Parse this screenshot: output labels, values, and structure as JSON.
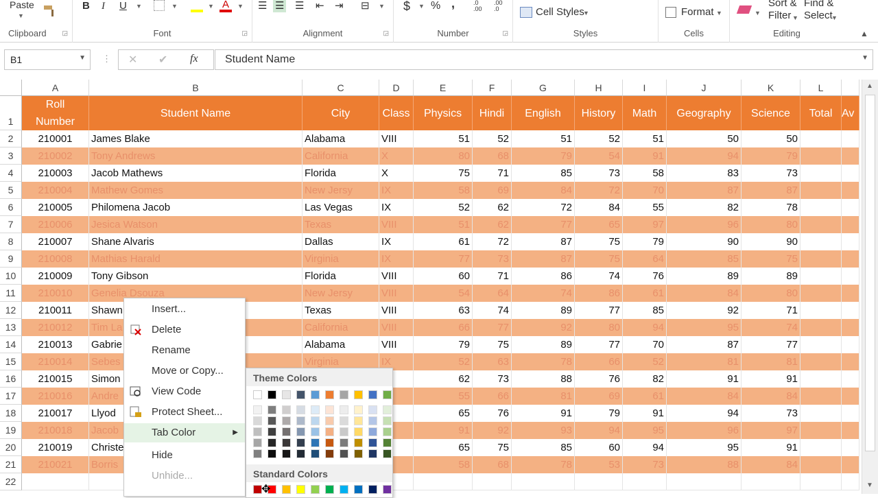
{
  "ribbon": {
    "paste_label": "Paste",
    "groups": {
      "clipboard": "Clipboard",
      "font": "Font",
      "alignment": "Alignment",
      "number": "Number",
      "styles": "Styles",
      "cells": "Cells",
      "editing": "Editing"
    },
    "cell_styles_label": "Cell Styles",
    "format_label": "Format",
    "sort_label": "Sort &",
    "filter_label": "Filter",
    "find_label": "Find &",
    "select_label": "Select",
    "bold": "B",
    "italic": "I",
    "underline": "U",
    "currency": "$",
    "percent": "%",
    "comma": ","
  },
  "formula_bar": {
    "name_box": "B1",
    "cancel_symbol": "✕",
    "enter_symbol": "✔",
    "fx_label": "fx",
    "content": "Student Name"
  },
  "columns": [
    {
      "letter": "A",
      "header_line1": "Roll",
      "header_line2": "Number"
    },
    {
      "letter": "B",
      "header": "Student Name"
    },
    {
      "letter": "C",
      "header": "City"
    },
    {
      "letter": "D",
      "header": "Class"
    },
    {
      "letter": "E",
      "header": "Physics"
    },
    {
      "letter": "F",
      "header": "Hindi"
    },
    {
      "letter": "G",
      "header": "English"
    },
    {
      "letter": "H",
      "header": "History"
    },
    {
      "letter": "I",
      "header": "Math"
    },
    {
      "letter": "J",
      "header": "Geography"
    },
    {
      "letter": "K",
      "header": "Science"
    },
    {
      "letter": "L",
      "header": "Total"
    },
    {
      "letter": "",
      "header": "Av"
    }
  ],
  "rows": [
    {
      "n": "1"
    },
    {
      "n": "2",
      "roll": "210001",
      "name": "James Blake",
      "city": "Alabama",
      "class": "VIII",
      "physics": "51",
      "hindi": "52",
      "english": "51",
      "history": "52",
      "math": "51",
      "geography": "50",
      "science": "50"
    },
    {
      "n": "3",
      "roll": "210002",
      "name": "Tony Andrews",
      "city": "California",
      "class": "X",
      "physics": "80",
      "hindi": "68",
      "english": "79",
      "history": "54",
      "math": "91",
      "geography": "94",
      "science": "79"
    },
    {
      "n": "4",
      "roll": "210003",
      "name": "Jacob Mathews",
      "city": "Florida",
      "class": "X",
      "physics": "75",
      "hindi": "71",
      "english": "85",
      "history": "73",
      "math": "58",
      "geography": "83",
      "science": "73"
    },
    {
      "n": "5",
      "roll": "210004",
      "name": "Mathew Gomes",
      "city": "New Jersy",
      "class": "IX",
      "physics": "58",
      "hindi": "69",
      "english": "84",
      "history": "72",
      "math": "70",
      "geography": "87",
      "science": "87"
    },
    {
      "n": "6",
      "roll": "210005",
      "name": "Philomena Jacob",
      "city": "Las Vegas",
      "class": "IX",
      "physics": "52",
      "hindi": "62",
      "english": "72",
      "history": "84",
      "math": "55",
      "geography": "82",
      "science": "78"
    },
    {
      "n": "7",
      "roll": "210006",
      "name": "Jesica Watson",
      "city": "Texas",
      "class": "VIII",
      "physics": "51",
      "hindi": "62",
      "english": "77",
      "history": "65",
      "math": "97",
      "geography": "96",
      "science": "80"
    },
    {
      "n": "8",
      "roll": "210007",
      "name": "Shane Alvaris",
      "city": "Dallas",
      "class": "IX",
      "physics": "61",
      "hindi": "72",
      "english": "87",
      "history": "75",
      "math": "79",
      "geography": "90",
      "science": "90"
    },
    {
      "n": "9",
      "roll": "210008",
      "name": "Mathias Harald",
      "city": "Virginia",
      "class": "IX",
      "physics": "77",
      "hindi": "73",
      "english": "87",
      "history": "75",
      "math": "64",
      "geography": "85",
      "science": "75"
    },
    {
      "n": "10",
      "roll": "210009",
      "name": "Tony Gibson",
      "city": "Florida",
      "class": "VIII",
      "physics": "60",
      "hindi": "71",
      "english": "86",
      "history": "74",
      "math": "76",
      "geography": "89",
      "science": "89"
    },
    {
      "n": "11",
      "roll": "210010",
      "name": "Genelia Dsouza",
      "city": "New Jersy",
      "class": "VIII",
      "physics": "54",
      "hindi": "64",
      "english": "74",
      "history": "86",
      "math": "61",
      "geography": "84",
      "science": "80"
    },
    {
      "n": "12",
      "roll": "210011",
      "name": "Shawn",
      "city": "Texas",
      "class": "VIII",
      "physics": "63",
      "hindi": "74",
      "english": "89",
      "history": "77",
      "math": "85",
      "geography": "92",
      "science": "71"
    },
    {
      "n": "13",
      "roll": "210012",
      "name": "Tim La",
      "city": "California",
      "class": "VIII",
      "physics": "66",
      "hindi": "77",
      "english": "92",
      "history": "80",
      "math": "94",
      "geography": "95",
      "science": "74"
    },
    {
      "n": "14",
      "roll": "210013",
      "name": "Gabrie",
      "city": "Alabama",
      "class": "VIII",
      "physics": "79",
      "hindi": "75",
      "english": "89",
      "history": "77",
      "math": "70",
      "geography": "87",
      "science": "77"
    },
    {
      "n": "15",
      "roll": "210014",
      "name": "Sebes",
      "city": "Virginia",
      "class": "IX",
      "physics": "52",
      "hindi": "63",
      "english": "78",
      "history": "66",
      "math": "52",
      "geography": "81",
      "science": "81"
    },
    {
      "n": "16",
      "roll": "210015",
      "name": "Simon",
      "city": "",
      "class": "",
      "physics": "62",
      "hindi": "73",
      "english": "88",
      "history": "76",
      "math": "82",
      "geography": "91",
      "science": "91"
    },
    {
      "n": "17",
      "roll": "210016",
      "name": "Andre",
      "city": "",
      "class": "",
      "physics": "55",
      "hindi": "66",
      "english": "81",
      "history": "69",
      "math": "61",
      "geography": "84",
      "science": "84"
    },
    {
      "n": "18",
      "roll": "210017",
      "name": "Llyod",
      "city": "",
      "class": "",
      "physics": "65",
      "hindi": "76",
      "english": "91",
      "history": "79",
      "math": "91",
      "geography": "94",
      "science": "73"
    },
    {
      "n": "19",
      "roll": "210018",
      "name": "Jacob",
      "city": "",
      "class": "",
      "physics": "91",
      "hindi": "92",
      "english": "93",
      "history": "94",
      "math": "95",
      "geography": "96",
      "science": "97"
    },
    {
      "n": "20",
      "roll": "210019",
      "name": "Christe",
      "city": "",
      "class": "",
      "physics": "65",
      "hindi": "75",
      "english": "85",
      "history": "60",
      "math": "94",
      "geography": "95",
      "science": "91"
    },
    {
      "n": "21",
      "roll": "210021",
      "name": "Borris",
      "city": "",
      "class": "",
      "physics": "58",
      "hindi": "68",
      "english": "78",
      "history": "53",
      "math": "73",
      "geography": "88",
      "science": "84"
    },
    {
      "n": "22"
    }
  ],
  "context_menu": {
    "items": [
      "Insert...",
      "Delete",
      "Rename",
      "Move or Copy...",
      "View Code",
      "Protect Sheet...",
      "Tab Color",
      "Hide",
      "Unhide..."
    ]
  },
  "tab_color_palette": {
    "theme_title": "Theme Colors",
    "standard_title": "Standard Colors",
    "theme_top": [
      "#ffffff",
      "#000000",
      "#e7e6e6",
      "#44546a",
      "#5b9bd5",
      "#ed7d31",
      "#a5a5a5",
      "#ffc000",
      "#4472c4",
      "#70ad47"
    ],
    "theme_cols": [
      [
        "#f2f2f2",
        "#d9d9d9",
        "#bfbfbf",
        "#a6a6a6",
        "#808080"
      ],
      [
        "#7f7f7f",
        "#595959",
        "#404040",
        "#262626",
        "#0d0d0d"
      ],
      [
        "#d0cece",
        "#aeaaaa",
        "#757171",
        "#3b3838",
        "#171616"
      ],
      [
        "#d6dce4",
        "#adb9ca",
        "#8497b0",
        "#333f4f",
        "#222b35"
      ],
      [
        "#ddebf7",
        "#bdd7ee",
        "#9bc2e6",
        "#2f75b5",
        "#1f4e78"
      ],
      [
        "#fce4d6",
        "#f8cbad",
        "#f4b084",
        "#c65911",
        "#833c0b"
      ],
      [
        "#ededed",
        "#dbdbdb",
        "#c9c9c9",
        "#7b7b7b",
        "#525252"
      ],
      [
        "#fff2cc",
        "#ffe699",
        "#ffd966",
        "#bf8f00",
        "#7f6000"
      ],
      [
        "#d9e1f2",
        "#b4c6e7",
        "#8ea9db",
        "#305496",
        "#203764"
      ],
      [
        "#e2efda",
        "#c6e0b4",
        "#a9d08e",
        "#548235",
        "#375623"
      ]
    ],
    "standard": [
      "#c00000",
      "#ff0000",
      "#ffc000",
      "#ffff00",
      "#92d050",
      "#00b050",
      "#00b0f0",
      "#0070c0",
      "#002060",
      "#7030a0"
    ]
  }
}
